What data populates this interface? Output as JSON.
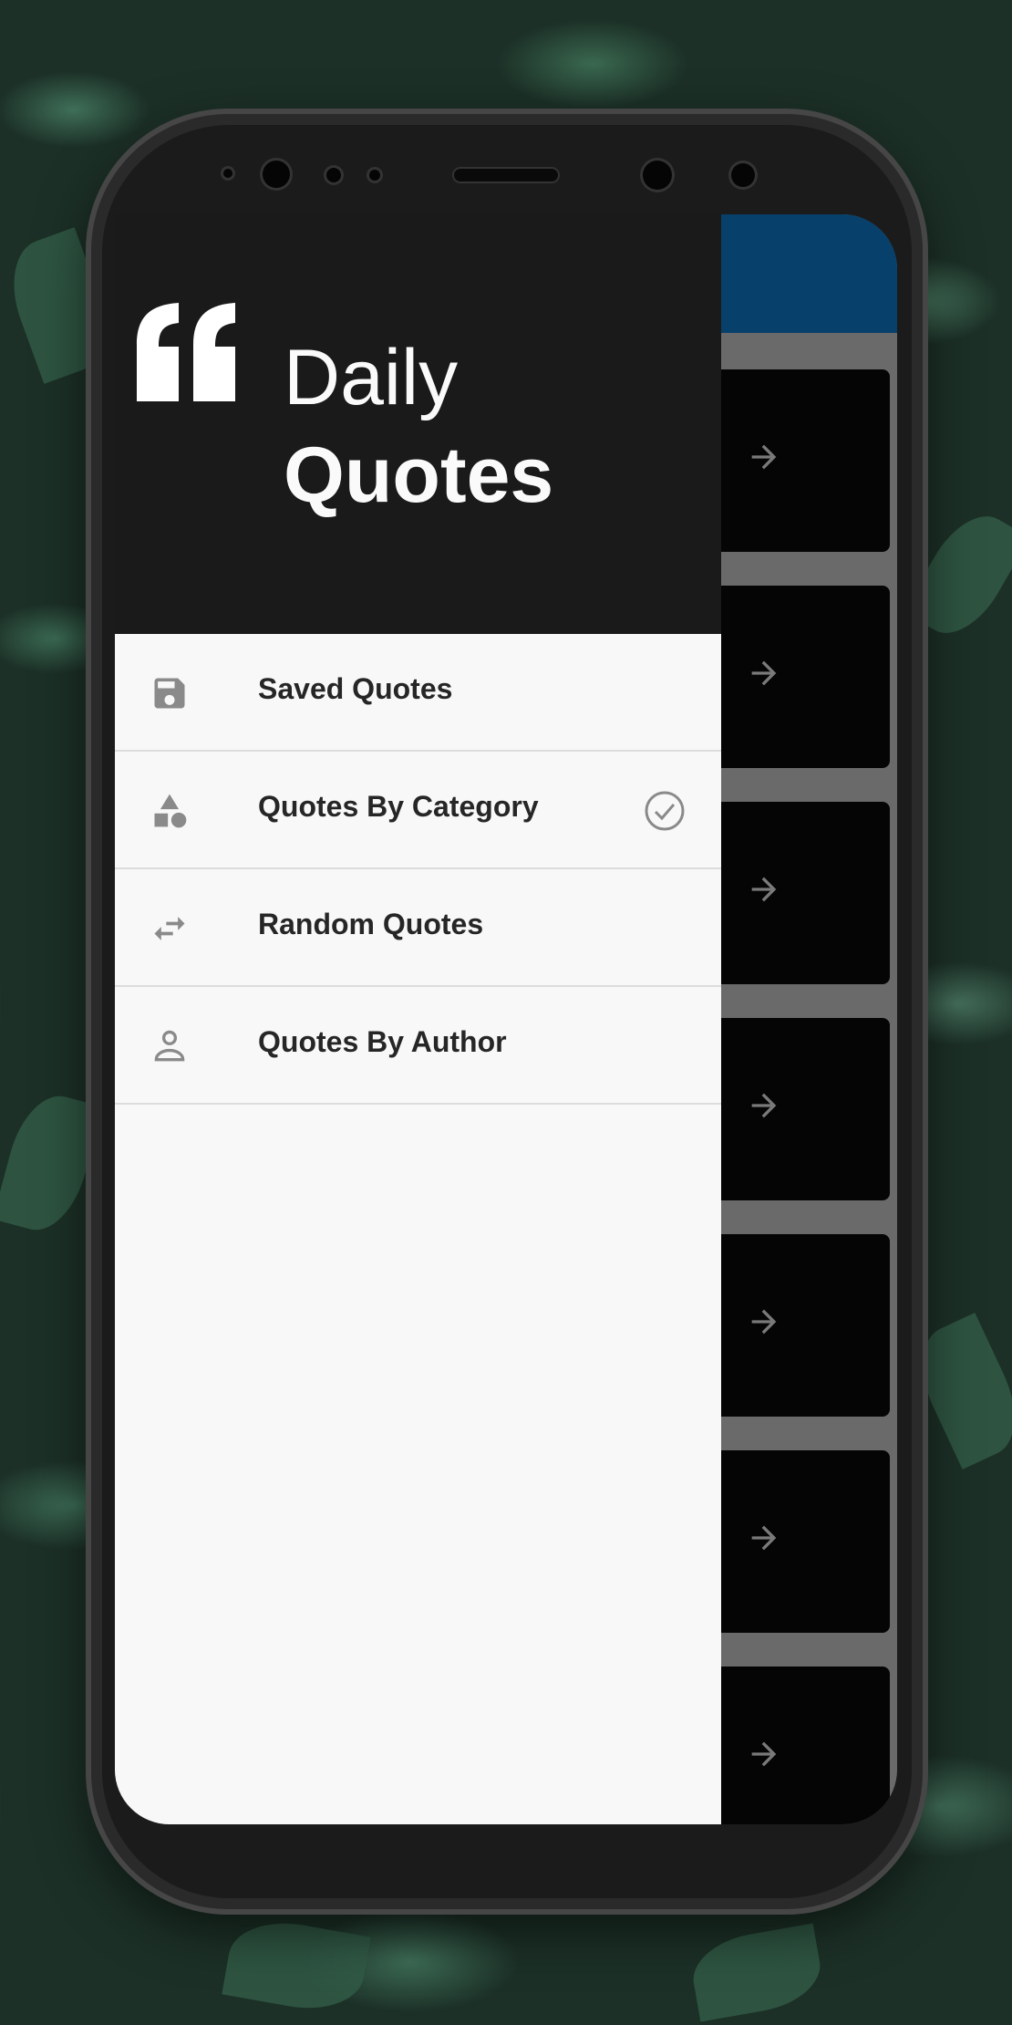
{
  "app": {
    "title_line1": "Daily",
    "title_line2": "Quotes",
    "accent_color": "#07406b",
    "header_bg": "#1a1a1a"
  },
  "drawer": {
    "items": [
      {
        "label": "Saved Quotes",
        "icon": "save-icon",
        "selected": false
      },
      {
        "label": "Quotes By Category",
        "icon": "category-icon",
        "selected": true
      },
      {
        "label": "Random Quotes",
        "icon": "shuffle-icon",
        "selected": false
      },
      {
        "label": "Quotes By Author",
        "icon": "person-icon",
        "selected": false
      }
    ]
  },
  "list": {
    "cards": [
      {
        "icon": "arrow-right-icon"
      },
      {
        "icon": "arrow-right-icon"
      },
      {
        "icon": "arrow-right-icon"
      },
      {
        "icon": "arrow-right-icon"
      },
      {
        "icon": "arrow-right-icon"
      },
      {
        "icon": "arrow-right-icon"
      },
      {
        "icon": "arrow-right-icon"
      }
    ]
  }
}
